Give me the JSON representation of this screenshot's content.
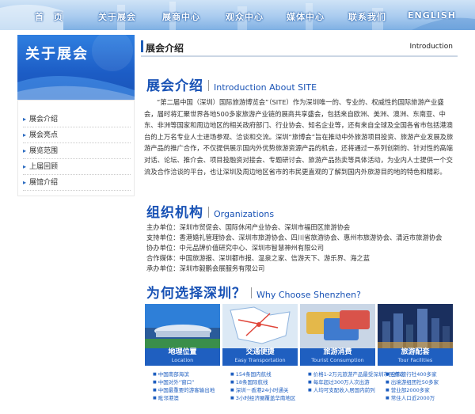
{
  "nav": {
    "items": [
      "首　页",
      "关于展会",
      "展商中心",
      "观众中心",
      "媒体中心",
      "联系我们",
      "ENGLISH"
    ]
  },
  "banner": {
    "title": "关于展会"
  },
  "sidebar": {
    "items": [
      "展会介绍",
      "展会亮点",
      "展览范围",
      "上届回顾",
      "展馆介绍"
    ]
  },
  "main": {
    "header_cn": "展会介绍",
    "header_en": "Introduction"
  },
  "intro": {
    "title_cn": "展会介绍",
    "title_en": "Introduction About SITE",
    "text": "“第二届中国（深圳）国际旅游博览会”（SITE）作为深圳唯一的、专业的、权威性的国际旅游产业盛会，届时将汇聚世界各地500多家旅游产业链的展商共享盛会，包括来自欧洲、美洲、澳洲、东南亚、中东、非洲等国家和周边地区的相关政府部门、行业协会、知名企业等，还有来自全球及全国各省市包括港澳台的上万名专业人士进场参观、洽谈和交流。深圳“旅博会”旨在推动中外旅游项目投资、旅游产业发展及旅游产品的推广合作，不仅提供展示国内外优势旅游资源产品的机会，还将通过一系列创新的、针对性的高端对话、论坛、推介会、项目投融资对接会、专题研讨会、旅游产品热卖等具体活动，为业内人士提供一个交流及合作洽谈的平台，也让深圳及周边地区省市的市民更直观的了解到国内外旅游目的地的特色和精彩。"
  },
  "org": {
    "title_cn": "组织机构",
    "title_en": "Organizations",
    "lines": [
      "主办单位：深圳市贸促会、国际休闲产业协会、深圳市福田区旅游协会",
      "支持单位：香港婚礼管理协会、深圳市旅游协会、四川省旅游协会、惠州市旅游协会、清远市旅游协会",
      "协办单位：中元品牌价值研究中心、深圳市智慧神州有限公司",
      "合作媒体：中国旅游报、深圳都市报、温泉之家、信游天下、游乐界、海之蓝",
      "承办单位：深圳市毅鹏会展服务有限公司"
    ]
  },
  "why": {
    "title_cn": "为何选择深圳？",
    "title_en": "Why Choose Shenzhen?",
    "tiles": [
      {
        "title": "地理位置",
        "sub": "Location",
        "bullets": [
          "中国南部海滨",
          "中国对外“窗口”",
          "中国最重要的游客输出地",
          "毗邻港澳"
        ]
      },
      {
        "title": "交通便捷",
        "sub": "Easy Transportation",
        "bullets": [
          "154条国内航线",
          "18条国际航线",
          "深圳－香港24小时通关",
          "3小时经济圈覆盖华南地区"
        ]
      },
      {
        "title": "旅游消费",
        "sub": "Tourist Consumption",
        "bullets": [
          "价格1-2万元旅游产品最受深圳市民喜欢",
          "每年超过300万人次出游",
          "人均可支配收入居国内前列"
        ]
      },
      {
        "title": "旅游配套",
        "sub": "Tour Facilities",
        "bullets": [
          "全市旅行社400多家",
          "出境游组团社50多家",
          "营业部2000多家",
          "常住人口近2000万"
        ]
      }
    ]
  },
  "colors": {
    "primary": "#1852b5",
    "tile_caption": "#1f5fc0",
    "nav_bg": "#a9cbef"
  }
}
